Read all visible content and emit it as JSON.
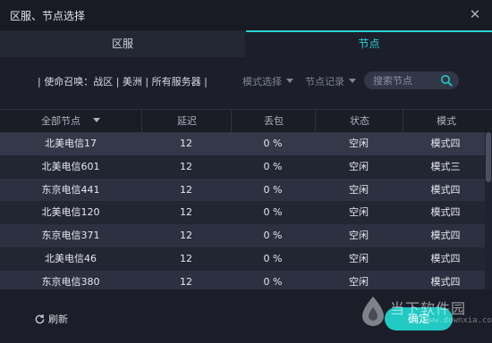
{
  "window": {
    "title": "区服、节点选择"
  },
  "tabs": [
    {
      "label": "区服"
    },
    {
      "label": "节点"
    }
  ],
  "filters": {
    "breadcrumb": "| 使命召唤：战区 | 美洲 | 所有服务器 |",
    "mode_select": "模式选择",
    "node_record": "节点记录",
    "search_placeholder": "搜索节点"
  },
  "table": {
    "headers": [
      "全部节点",
      "延迟",
      "丢包",
      "状态",
      "模式"
    ],
    "rows": [
      [
        "北美电信17",
        "12",
        "0 %",
        "空闲",
        "模式四"
      ],
      [
        "北美电信601",
        "12",
        "0 %",
        "空闲",
        "模式三"
      ],
      [
        "东京电信441",
        "12",
        "0 %",
        "空闲",
        "模式四"
      ],
      [
        "北美电信120",
        "12",
        "0 %",
        "空闲",
        "模式四"
      ],
      [
        "东京电信371",
        "12",
        "0 %",
        "空闲",
        "模式四"
      ],
      [
        "北美电信46",
        "12",
        "0 %",
        "空闲",
        "模式四"
      ],
      [
        "东京电信380",
        "12",
        "0 %",
        "空闲",
        "模式四"
      ]
    ]
  },
  "footer": {
    "refresh": "刷新",
    "confirm": "确定"
  },
  "watermark": {
    "text": "当下软件园",
    "url": "www.downxia.com"
  },
  "colors": {
    "accent": "#21c9c3",
    "background": "#1b1d28"
  }
}
